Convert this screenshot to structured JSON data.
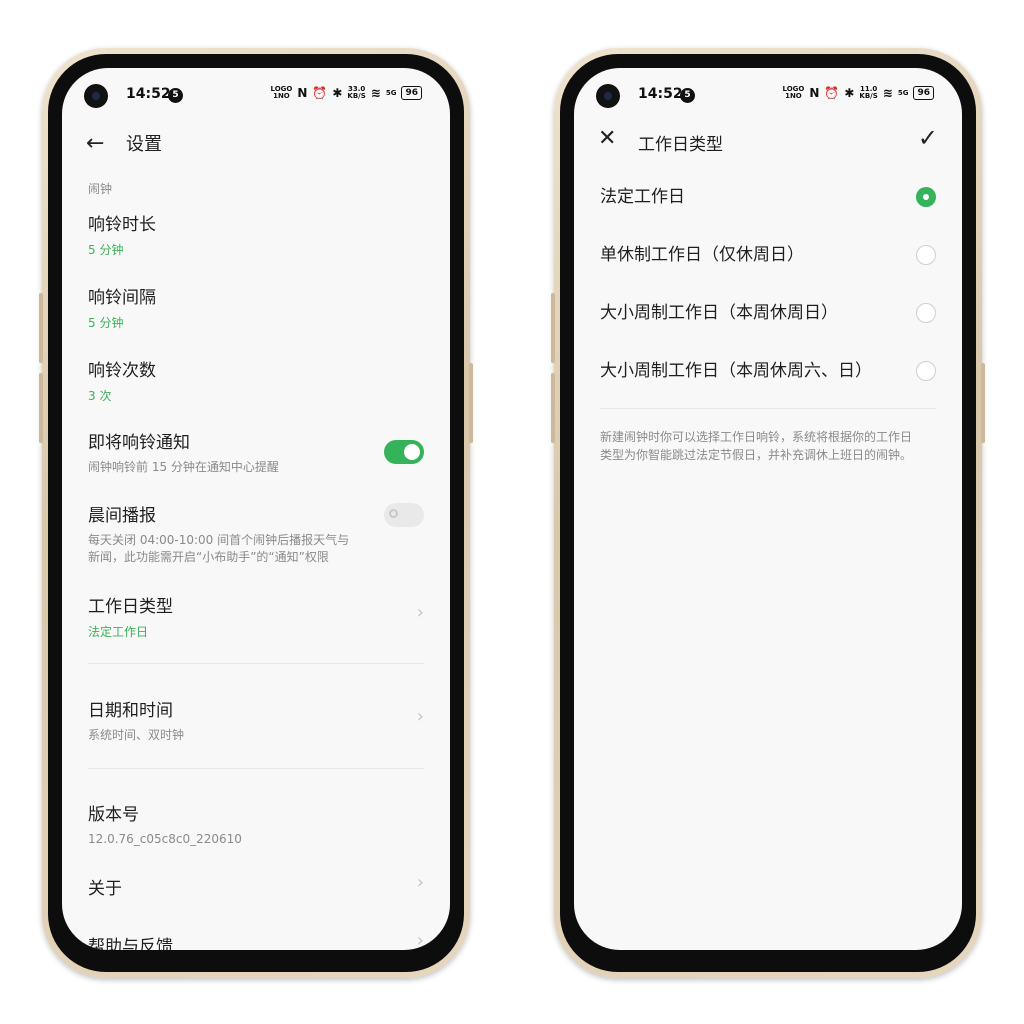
{
  "status_left": {
    "time": "14:52",
    "notif_count": "5",
    "net_speed": "33.0",
    "net_unit": "KB/S",
    "signal": "5G",
    "battery": "96",
    "lte": "LOGO",
    "lte2": "1NO"
  },
  "status_right": {
    "time": "14:52",
    "notif_count": "5",
    "net_speed": "11.0",
    "net_unit": "KB/S",
    "signal": "5G",
    "battery": "96",
    "lte": "LOGO",
    "lte2": "1NO"
  },
  "settings": {
    "title": "设置",
    "section": "闹钟",
    "ring_duration": {
      "title": "响铃时长",
      "value": "5 分钟"
    },
    "ring_interval": {
      "title": "响铃间隔",
      "value": "5 分钟"
    },
    "ring_count": {
      "title": "响铃次数",
      "value": "3 次"
    },
    "upcoming_notify": {
      "title": "即将响铃通知",
      "desc": "闹钟响铃前 15 分钟在通知中心提醒",
      "enabled": true
    },
    "morning_broadcast": {
      "title": "晨间播报",
      "desc_line1": "每天关闭 04:00-10:00 间首个闹钟后播报天气与",
      "desc_line2": "新闻，此功能需开启“小布助手”的“通知”权限",
      "enabled": false
    },
    "workday_type": {
      "title": "工作日类型",
      "value": "法定工作日"
    },
    "date_time": {
      "title": "日期和时间",
      "desc": "系统时间、双时钟"
    },
    "version": {
      "title": "版本号",
      "value": "12.0.76_c05c8c0_220610"
    },
    "about": {
      "title": "关于"
    },
    "help": {
      "title": "帮助与反馈"
    }
  },
  "workday_dialog": {
    "title": "工作日类型",
    "options": [
      {
        "label": "法定工作日",
        "selected": true
      },
      {
        "label": "单休制工作日（仅休周日）",
        "selected": false
      },
      {
        "label": "大小周制工作日（本周休周日）",
        "selected": false
      },
      {
        "label": "大小周制工作日（本周休周六、日）",
        "selected": false
      }
    ],
    "note_line1": "新建闹钟时你可以选择工作日响铃，系统将根据你的工作日",
    "note_line2": "类型为你智能跳过法定节假日，并补充调休上班日的闹钟。"
  },
  "colors": {
    "accent": "#34b35a",
    "accent_text": "#3cb15a",
    "frame": "#e6d6bd"
  }
}
